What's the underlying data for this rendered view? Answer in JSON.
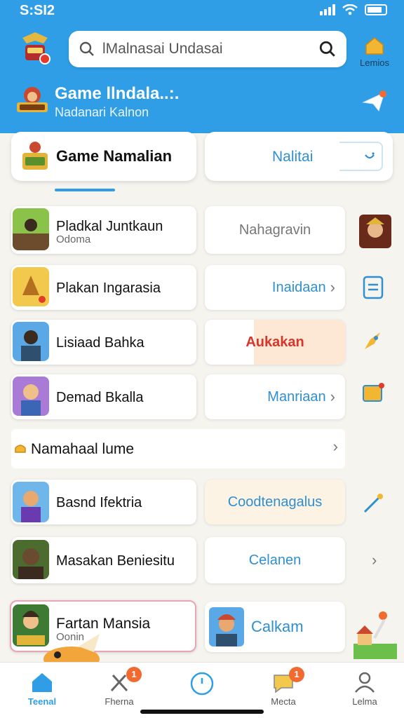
{
  "status": {
    "time": "S:SI2"
  },
  "search": {
    "placeholder": "lMalnasai Undasai"
  },
  "header": {
    "home_label": "Lemios",
    "title": "Game llndala..:.",
    "subtitle": "Nadanari Kalnon"
  },
  "top_cards": {
    "left_title": "Game Namalian",
    "right_label": "Nalitai"
  },
  "rows": [
    {
      "title": "Pladkal Juntkaun",
      "sub": "Odoma",
      "right": "Nahagravin",
      "right_color": "#777777"
    },
    {
      "title": "Plakan Ingarasia",
      "sub": "",
      "right": "Inaidaan",
      "right_color": "#2f8fcf"
    },
    {
      "title": "Lisiaad Bahka",
      "sub": "",
      "right": "Aukakan",
      "right_color": "#d9362b"
    },
    {
      "title": "Demad Bkalla",
      "sub": "",
      "right": "Manriaan",
      "right_color": "#2f8fcf"
    }
  ],
  "section": {
    "title": "Namahaal lume"
  },
  "rows2": [
    {
      "title": "Basnd Ifektria",
      "right": "Coodtenagalus"
    },
    {
      "title": "Masakan Beniesitu",
      "right": "Celanen"
    },
    {
      "title": "Fartan Mansia",
      "sub": "Oonin",
      "right": "Calkam"
    }
  ],
  "colors": {
    "accent": "#2f9ee6",
    "badge": "#f26a30",
    "link": "#2f8fcf"
  },
  "nav": [
    {
      "label": "Teenal",
      "icon": "home-icon",
      "active": true
    },
    {
      "label": "Fherna",
      "icon": "tools-icon",
      "badge": "1"
    },
    {
      "label": "",
      "icon": "clock-icon"
    },
    {
      "label": "Mecta",
      "icon": "chat-icon",
      "badge": "1"
    },
    {
      "label": "Lelma",
      "icon": "profile-icon"
    }
  ]
}
